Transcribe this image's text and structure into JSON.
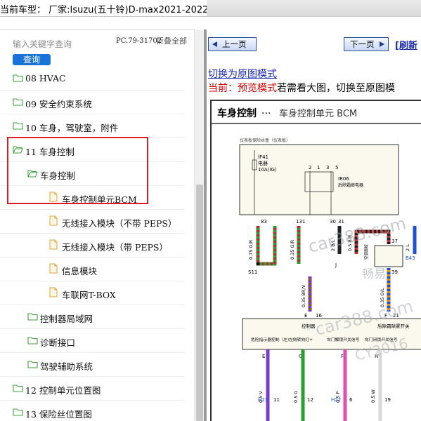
{
  "window": {
    "title": "当前车型：  厂家:Isuzu(五十铃)D-max2021-2022"
  },
  "sidebar": {
    "search_placeholder": "输入关键字查询",
    "search_button": "查询",
    "code": "PC.79-31702",
    "collapse_all": "折叠全部",
    "tree": [
      {
        "label": "08 HVAC",
        "icon": "folder-icon",
        "level": 0
      },
      {
        "label": "09 安全约束系统",
        "icon": "folder-icon",
        "level": 0
      },
      {
        "label": "10 车身，驾驶室，附件",
        "icon": "folder-icon",
        "level": 0
      },
      {
        "label": "11 车身控制",
        "icon": "folder-open-icon",
        "level": 0
      },
      {
        "label": "车身控制",
        "icon": "folder-open-icon",
        "level": 1
      },
      {
        "label": "车身控制单元BCM",
        "icon": "page-icon",
        "level": 2
      },
      {
        "label": "无线接入模块（不带 PEPS）",
        "icon": "page-icon",
        "level": 2
      },
      {
        "label": "无线接入模块（带 PEPS）",
        "icon": "page-icon",
        "level": 2
      },
      {
        "label": "信息模块",
        "icon": "page-icon",
        "level": 2
      },
      {
        "label": "车联网T-BOX",
        "icon": "page-icon",
        "level": 2
      },
      {
        "label": "控制器局域网",
        "icon": "folder-icon",
        "level": 1
      },
      {
        "label": "诊断接口",
        "icon": "folder-icon",
        "level": 1
      },
      {
        "label": "驾驶辅助系统",
        "icon": "folder-icon",
        "level": 1
      },
      {
        "label": "12 控制单元位置图",
        "icon": "folder-icon",
        "level": 0
      },
      {
        "label": "13 保险丝位置图",
        "icon": "folder-icon",
        "level": 0
      }
    ]
  },
  "viewer": {
    "prev_button": "上一页",
    "next_button": "下一页",
    "refresh": "[刷新",
    "switch_link": "切换为原图模式",
    "status_prefix": "当前：",
    "status_mode": "预览模式",
    "status_suffix": "若需看大图，切换至原图模",
    "diagram": {
      "title_main": "车身控制",
      "title_dots": "···",
      "title_sub": "车身控制单元 BCM",
      "fuse_box": "仪表板保险丝盒（仪表板）",
      "fuse": "IF41",
      "fuse_type": "电器",
      "fuse_rating": "10A(IG)",
      "relay": "IR06",
      "relay_name": "后除霜继电器",
      "pin_83": "83",
      "pin_131": "131",
      "pin_30": "30",
      "pin_31": "31",
      "pin_37": "37",
      "pin_39": "39",
      "pin_16": "16",
      "pin_21": "21",
      "pin_1": "1",
      "pin_2": "2",
      "pin_3": "3",
      "pin_5": "5",
      "wire_1": "0.75 G/R",
      "wire_2": "0.35 G/R",
      "wire_3": "2 B/L",
      "wire_4": "0.5 B/R",
      "wire_5": "2 L",
      "wire_6": "0.35 BR/V",
      "wire_7": "0.35 O/L",
      "wire_8": "0.5 V",
      "wire_9": "0.5 G",
      "wire_10": "0.5 P",
      "wire_11": "0.5 W",
      "splice_s11": "S11",
      "splice_j": "J",
      "conn_b43": "B43",
      "b43_name": "空调面板",
      "letter_e": "E",
      "letter_f": "F",
      "bcm_label": "控制器",
      "bcm_right": "后除霜除雾开关",
      "sig_1": "危险指示器控制（左）",
      "sig_2": "左侧转向灯+",
      "sig_3": "车门解锁开关信号",
      "sig_4": "车门闭锁开关信号",
      "h23": "H23",
      "h22": "H22",
      "pin_11": "11",
      "pin_12": "12",
      "pin_6": "6",
      "pin_19": "19",
      "pin_e2": "E",
      "pin_f2": "F",
      "pin_g": "G",
      "pin_h": "H",
      "wm_1": "car388.com",
      "wm_2": "畅易",
      "wm_3": "car388.com",
      "wm_4": "CY2016"
    }
  }
}
